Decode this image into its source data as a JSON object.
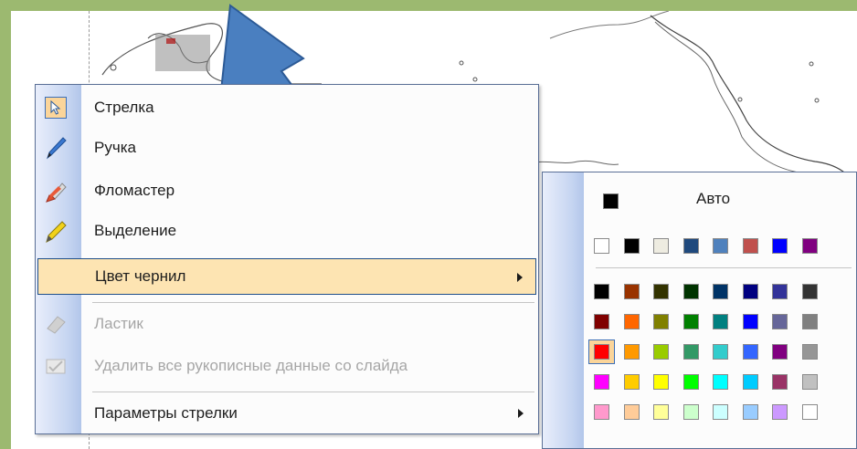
{
  "menu": {
    "items": [
      {
        "label": "Стрелка",
        "icon": "pointer-arrow-icon",
        "checked": true,
        "disabled": false
      },
      {
        "label": "Ручка",
        "icon": "pen-icon",
        "disabled": false
      },
      {
        "label": "Фломастер",
        "icon": "felt-tip-pen-icon",
        "disabled": false
      },
      {
        "label": "Выделение",
        "icon": "highlighter-icon",
        "disabled": false
      },
      {
        "label": "Цвет чернил",
        "icon": "",
        "submenu": true,
        "highlighted": true
      },
      {
        "label": "Ластик",
        "icon": "eraser-icon",
        "disabled": true
      },
      {
        "label": "Удалить все рукописные данные со слайда",
        "icon": "erase-all-ink-icon",
        "disabled": true
      },
      {
        "label": "Параметры стрелки",
        "icon": "",
        "submenu": true
      }
    ]
  },
  "ink_colors": {
    "auto_label": "Авто",
    "auto_color": "#000000",
    "theme_row": [
      "#ffffff",
      "#000000",
      "#eeece1",
      "#1f497d",
      "#4f81bd",
      "#c0504d",
      "#0000ff",
      "#800080"
    ],
    "standard_rows": [
      [
        "#000000",
        "#993300",
        "#333300",
        "#003300",
        "#003366",
        "#000080",
        "#333399",
        "#333333"
      ],
      [
        "#800000",
        "#ff6600",
        "#808000",
        "#008000",
        "#008080",
        "#0000ff",
        "#666699",
        "#808080"
      ],
      [
        "#ff0000",
        "#ff9900",
        "#99cc00",
        "#339966",
        "#33cccc",
        "#3366ff",
        "#800080",
        "#969696"
      ],
      [
        "#ff00ff",
        "#ffcc00",
        "#ffff00",
        "#00ff00",
        "#00ffff",
        "#00ccff",
        "#993366",
        "#c0c0c0"
      ],
      [
        "#ff99cc",
        "#ffcc99",
        "#ffff99",
        "#ccffcc",
        "#ccffff",
        "#99ccff",
        "#cc99ff",
        "#ffffff"
      ]
    ],
    "selected_color": "#ff0000"
  },
  "colors": {
    "accent_border": "#1f4f8a",
    "highlight_bg": "#fde4b2",
    "pointer_arrow": "#4a7fc0"
  }
}
